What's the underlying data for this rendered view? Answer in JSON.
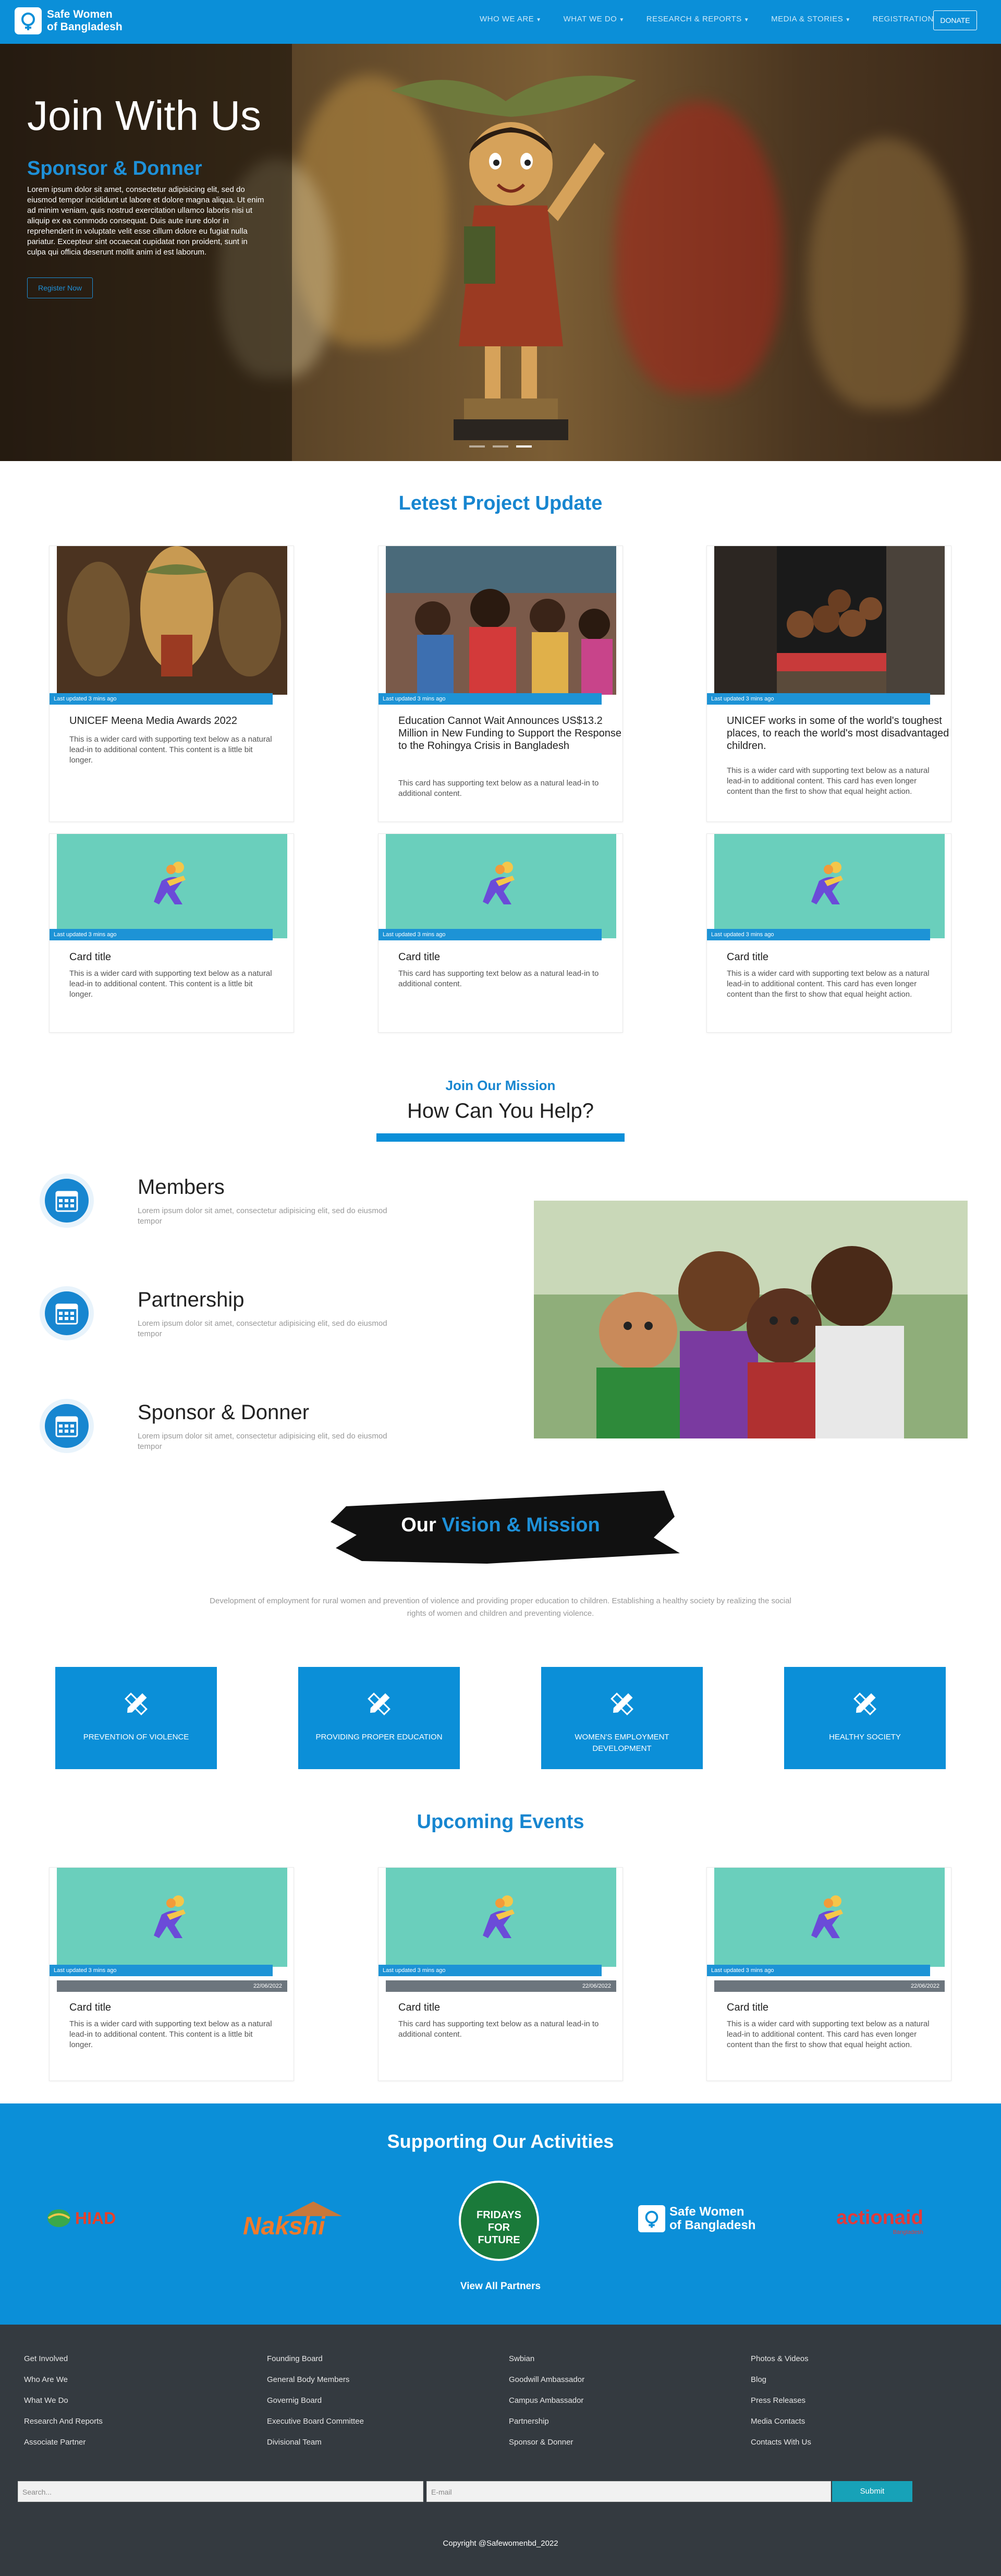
{
  "nav": {
    "brand_line1": "Safe Women",
    "brand_line2": "of Bangladesh",
    "links": [
      "WHO WE ARE",
      "WHAT WE DO",
      "RESEARCH & REPORTS",
      "MEDIA & STORIES",
      "REGISTRATION"
    ],
    "donate": "DONATE"
  },
  "hero": {
    "title": "Join With Us",
    "subtitle": "Sponsor & Donner",
    "text": "Lorem ipsum dolor sit amet, consectetur adipisicing elit, sed do eiusmod tempor incididunt ut labore et dolore magna aliqua. Ut enim ad minim veniam, quis nostrud exercitation ullamco laboris nisi ut aliquip ex ea commodo consequat. Duis aute irure dolor in reprehenderit in voluptate velit esse cillum dolore eu fugiat nulla pariatur. Excepteur sint occaecat cupidatat non proident, sunt in culpa qui officia deserunt mollit anim id est laborum.",
    "button": "Register Now"
  },
  "projects": {
    "title": "Letest Project Update",
    "cards": [
      {
        "tag": "Last updated 3 mins ago",
        "title": "UNICEF Meena Media Awards 2022",
        "text": "This is a wider card with supporting text below as a natural lead-in to additional content. This content is a little bit longer."
      },
      {
        "tag": "Last updated 3 mins ago",
        "title": "Education Cannot Wait Announces US$13.2 Million in New Funding to Support the Response to the Rohingya Crisis in Bangladesh",
        "text": "This card has supporting text below as a natural lead-in to additional content."
      },
      {
        "tag": "Last updated 3 mins ago",
        "title": "UNICEF works in some of the world's toughest places, to reach the world's most disadvantaged children.",
        "text": "This is a wider card with supporting text below as a natural lead-in to additional content. This card has even longer content than the first to show that equal height action."
      },
      {
        "tag": "Last updated 3 mins ago",
        "title": "Card title",
        "text": "This is a wider card with supporting text below as a natural lead-in to additional content. This content is a little bit longer."
      },
      {
        "tag": "Last updated 3 mins ago",
        "title": "Card title",
        "text": "This card has supporting text below as a natural lead-in to additional content."
      },
      {
        "tag": "Last updated 3 mins ago",
        "title": "Card title",
        "text": "This is a wider card with supporting text below as a natural lead-in to additional content. This card has even longer content than the first to show that equal height action."
      }
    ]
  },
  "help": {
    "kicker": "Join Our Mission",
    "title": "How Can You Help?",
    "items": [
      {
        "title": "Members",
        "text": "Lorem ipsum dolor sit amet, consectetur adipisicing elit, sed do eiusmod tempor"
      },
      {
        "title": "Partnership",
        "text": "Lorem ipsum dolor sit amet, consectetur adipisicing elit, sed do eiusmod tempor"
      },
      {
        "title": "Sponsor & Donner",
        "text": "Lorem ipsum dolor sit amet, consectetur adipisicing elit, sed do eiusmod tempor"
      }
    ]
  },
  "vision": {
    "title_our": "Our",
    "title_rest": "Vision & Mission",
    "text": "Development of employment for rural women and prevention of violence and providing proper education to children. Establishing a healthy society by realizing the social rights of women and children and preventing violence.",
    "cards": [
      "PREVENTION OF VIOLENCE",
      "PROVIDING PROPER EDUCATION",
      "WOMEN'S EMPLOYMENT DEVELOPMENT",
      "HEALTHY SOCIETY"
    ]
  },
  "events": {
    "title": "Upcoming Events",
    "cards": [
      {
        "tag": "Last updated 3 mins ago",
        "date": "22/06/2022",
        "title": "Card title",
        "text": "This is a wider card with supporting text below as a natural lead-in to additional content. This content is a little bit longer."
      },
      {
        "tag": "Last updated 3 mins ago",
        "date": "22/06/2022",
        "title": "Card title",
        "text": "This card has supporting text below as a natural lead-in to additional content."
      },
      {
        "tag": "Last updated 3 mins ago",
        "date": "22/06/2022",
        "title": "Card title",
        "text": "This is a wider card with supporting text below as a natural lead-in to additional content. This card has even longer content than the first to show that equal height action."
      }
    ]
  },
  "support": {
    "title": "Supporting Our Activities",
    "partner_hiad": "HIAD",
    "partner_nakshi": "Nakshi",
    "partner_fff": "FRIDAYS FOR FUTURE",
    "partner_sw1": "Safe Women",
    "partner_sw2": "of Bangladesh",
    "partner_aa": "actionaid",
    "partner_aa_sub": "Bangladesh",
    "view_all": "View All Partners"
  },
  "footer": {
    "col1": [
      "Get Involved",
      "Who Are We",
      "What We Do",
      "Research And Reports",
      "Associate Partner"
    ],
    "col2": [
      "Founding Board",
      "General Body Members",
      "Governig Board",
      "Executive Board Committee",
      "Divisional Team"
    ],
    "col3": [
      "Swbian",
      "Goodwill Ambassador",
      "Campus Ambassador",
      "Partnership",
      "Sponsor & Donner"
    ],
    "col4": [
      "Photos & Videos",
      "Blog",
      "Press Releases",
      "Media Contacts",
      "Contacts With Us"
    ],
    "search_placeholder": "Search...",
    "email_placeholder": "E-mail",
    "submit": "Submit",
    "copyright": "Copyright @Safewomenbd_2022"
  },
  "colors": {
    "brand": "#0b8fd8",
    "card_img": "#6acfbc",
    "footer": "#343a40"
  }
}
